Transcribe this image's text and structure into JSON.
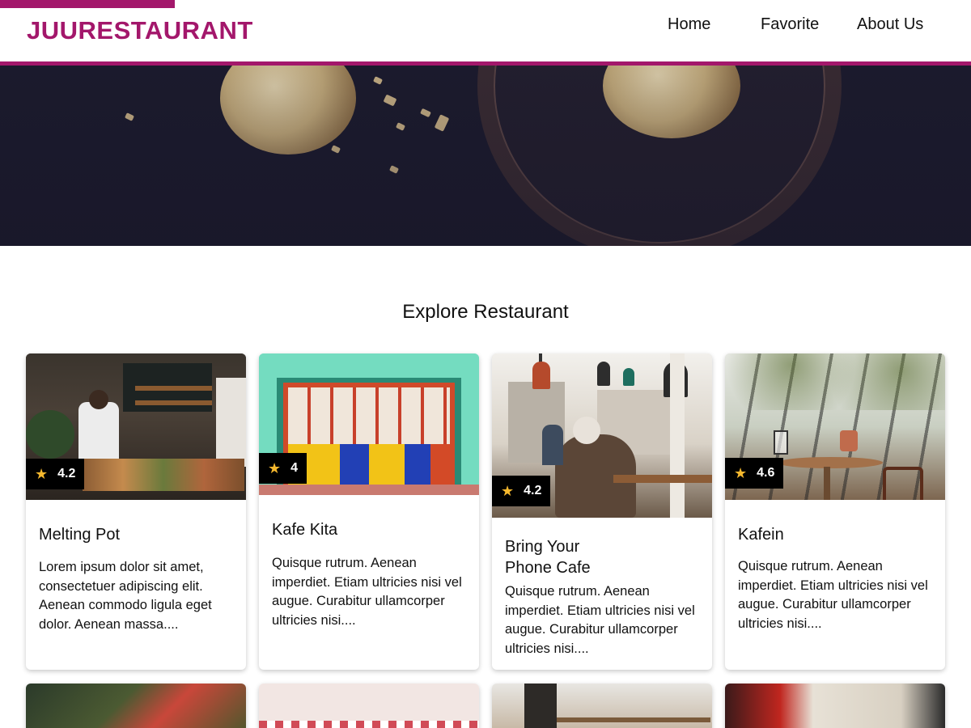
{
  "header": {
    "brand": "JUURESTAURANT",
    "nav": [
      "Home",
      "Favorite",
      "About Us"
    ],
    "accent_color": "#a3176b"
  },
  "section_title": "Explore Restaurant",
  "restaurants": [
    {
      "name": "Melting Pot",
      "rating": "4.2",
      "description": "Lorem ipsum dolor sit amet, consectetuer adipiscing elit. Aenean commodo ligula eget dolor. Aenean massa...."
    },
    {
      "name": "Kafe Kita",
      "rating": "4",
      "description": "Quisque rutrum. Aenean imperdiet. Etiam ultricies nisi vel augue. Curabitur ullamcorper ultricies nisi...."
    },
    {
      "name": "Bring Your Phone Cafe",
      "rating": "4.2",
      "description": "Quisque rutrum. Aenean imperdiet. Etiam ultricies nisi vel augue. Curabitur ullamcorper ultricies nisi...."
    },
    {
      "name": "Kafein",
      "rating": "4.6",
      "description": "Quisque rutrum. Aenean imperdiet. Etiam ultricies nisi vel augue. Curabitur ullamcorper ultricies nisi...."
    }
  ],
  "icons": {
    "rating": "star-icon"
  }
}
